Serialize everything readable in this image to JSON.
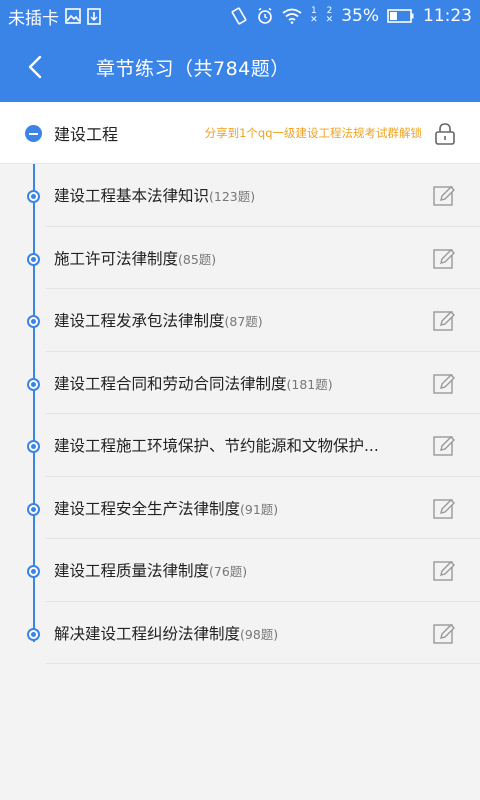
{
  "status_bar": {
    "carrier": "未插卡",
    "sim1": "1",
    "sim2": "2",
    "battery": "35%",
    "time": "11:23"
  },
  "header": {
    "title": "章节练习（共784题）"
  },
  "chapter": {
    "title": "建设工程",
    "share_text": "分享到1个qq一级建设工程法规考试群解锁"
  },
  "sections": [
    {
      "name": "建设工程基本法律知识",
      "count": "(123题)"
    },
    {
      "name": "施工许可法律制度",
      "count": "(85题)"
    },
    {
      "name": "建设工程发承包法律制度",
      "count": "(87题)"
    },
    {
      "name": "建设工程合同和劳动合同法律制度",
      "count": "(181题)"
    },
    {
      "name": "建设工程施工环境保护、节约能源和文物保护...",
      "count": ""
    },
    {
      "name": "建设工程安全生产法律制度",
      "count": "(91题)"
    },
    {
      "name": "建设工程质量法律制度",
      "count": "(76题)"
    },
    {
      "name": "解决建设工程纠纷法律制度",
      "count": "(98题)"
    }
  ],
  "colors": {
    "primary": "#3a84e8",
    "share_text": "#f0a21e"
  }
}
